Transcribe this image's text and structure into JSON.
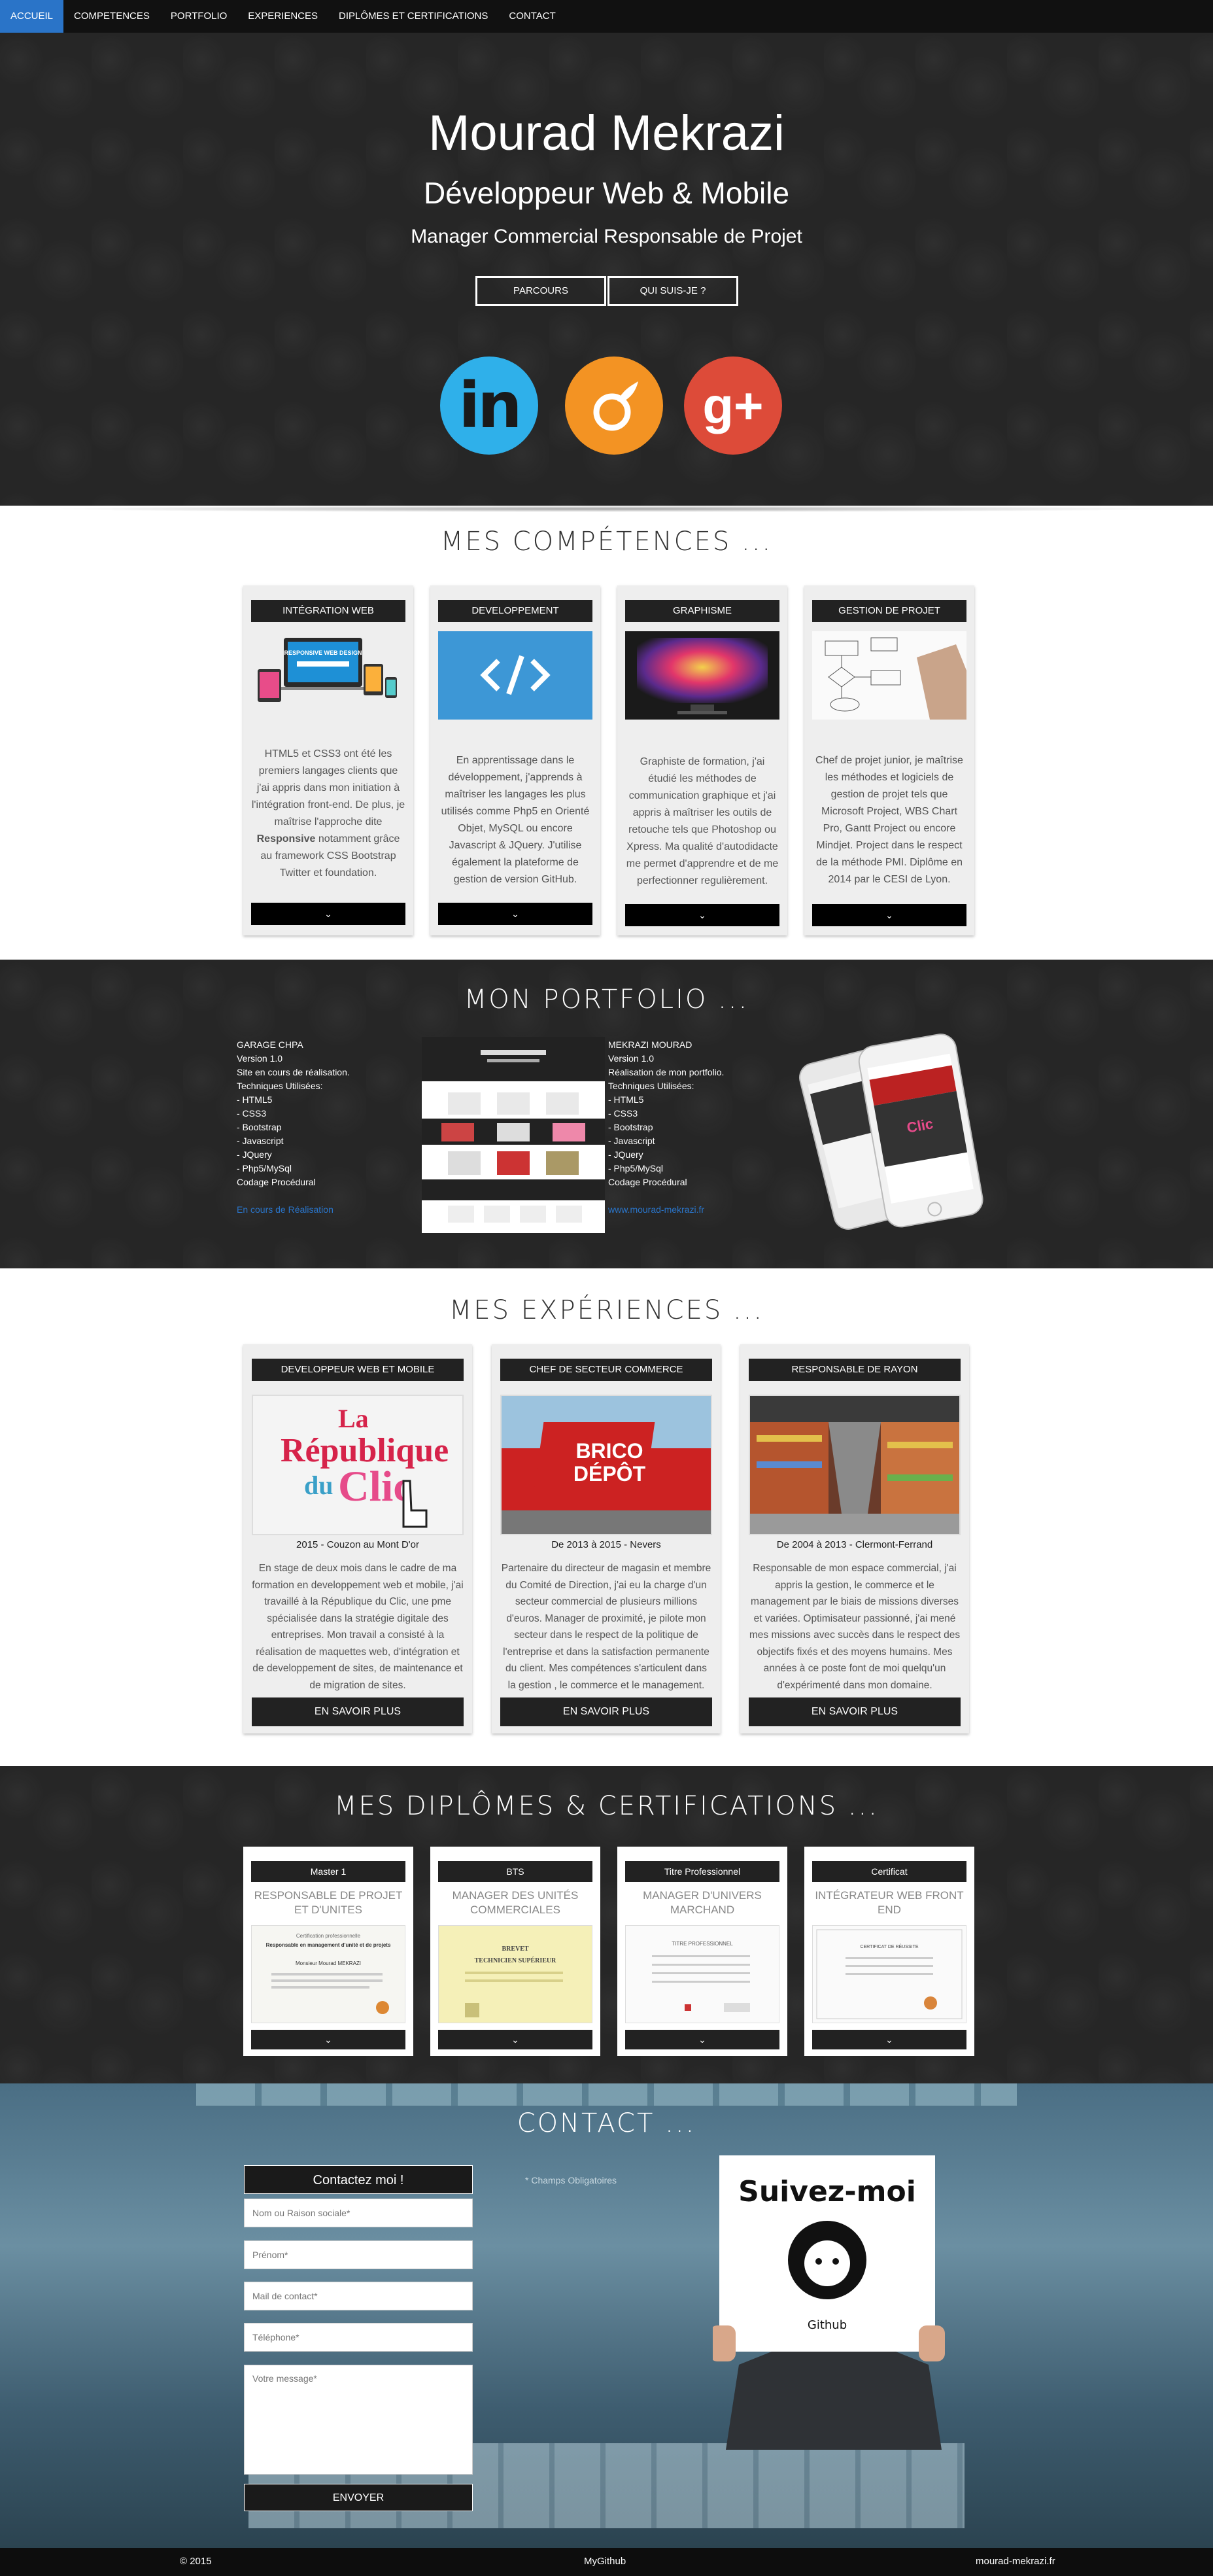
{
  "nav": {
    "items": [
      "ACCUEIL",
      "COMPETENCES",
      "PORTFOLIO",
      "EXPERIENCES",
      "DIPLÔMES ET CERTIFICATIONS",
      "CONTACT"
    ],
    "active_index": 0,
    "active_color": "#2a74c8"
  },
  "hero": {
    "name": "Mourad Mekrazi",
    "title1": "Développeur Web & Mobile",
    "title2": "Manager Commercial Responsable de Projet",
    "btn_parcours": "PARCOURS",
    "btn_qui": "QUI SUIS-JE ?",
    "social": {
      "linkedin_icon": "linkedin-icon",
      "linkedin_text": "in",
      "viadeo_icon": "viadeo-icon",
      "gplus_icon": "google-plus-icon",
      "gplus_text": "g+"
    }
  },
  "skills": {
    "title": "MES COMPÉTENCES ...",
    "cards": [
      {
        "tag": "INTÉGRATION WEB",
        "text_pre": "HTML5 et CSS3 ont été les premiers langages clients que j'ai appris dans mon initiation à l'intégration front-end. De plus, je maîtrise l'approche dite ",
        "text_bold": "Responsive",
        "text_post": " notamment grâce au framework CSS Bootstrap Twitter et foundation.",
        "more": "⌄"
      },
      {
        "tag": "DEVELOPPEMENT",
        "text": "En apprentissage dans le développement, j'apprends à maîtriser les langages les plus utilisés comme Php5 en Orienté Objet, MySQL ou encore Javascript & JQuery. J'utilise également la plateforme de gestion de version GitHub.",
        "more": "⌄"
      },
      {
        "tag": "GRAPHISME",
        "text": "Graphiste de formation, j'ai étudié les méthodes de communication graphique et j'ai appris à maîtriser les outils de retouche tels que Photoshop ou Xpress. Ma qualité d'autodidacte me permet d'apprendre et de me perfectionner regulièrement.",
        "more": "⌄"
      },
      {
        "tag": "GESTION DE PROJET",
        "text": "Chef de projet junior, je maîtrise les méthodes et logiciels de gestion de projet tels que Microsoft Project, WBS Chart Pro, Gantt Project ou encore Mindjet. Project dans le respect de la méthode PMI. Diplôme en 2014 par le CESI de Lyon.",
        "more": "⌄"
      }
    ],
    "responsive_design_img_label": "RESPONSIVE WEB DESIGN"
  },
  "portfolio": {
    "title": "MON PORTFOLIO ...",
    "project1": {
      "lines": [
        "GARAGE CHPA",
        "Version 1.0",
        "Site en cours de réalisation.",
        "Techniques Utilisées:",
        "- HTML5",
        "- CSS3",
        "- Bootstrap",
        "- Javascript",
        "- JQuery",
        "- Php5/MySql",
        "Codage Procédural"
      ],
      "link": "En cours de Réalisation"
    },
    "project2": {
      "lines": [
        "MEKRAZI MOURAD",
        "Version 1.0",
        "Réalisation de mon portfolio.",
        "Techniques Utilisées:",
        "- HTML5",
        "- CSS3",
        "- Bootstrap",
        "- Javascript",
        "- JQuery",
        "- Php5/MySql",
        "Codage Procédural"
      ],
      "link": "www.mourad-mekrazi.fr"
    }
  },
  "experiences": {
    "title": "MES EXPÉRIENCES ...",
    "cards": [
      {
        "tag": "DEVELOPPEUR WEB ET MOBILE",
        "logo_line1": "La",
        "logo_line2": "République",
        "logo_line3": "du",
        "logo_line4": "Clic",
        "date": "2015 - Couzon au Mont D'or",
        "text": "En stage de deux mois dans le cadre de ma formation en developpement web et mobile, j'ai travaillé à la République du Clic, une pme spécialisée dans la stratégie digitale des entreprises. Mon travail a consisté à la réalisation de maquettes web, d'intégration et de developpement de sites, de maintenance et de migration de sites.",
        "more": "EN SAVOIR PLUS"
      },
      {
        "tag": "CHEF DE SECTEUR COMMERCE",
        "store_sign_line1": "BRICO",
        "store_sign_line2": "DÉPÔT",
        "date": "De 2013 à 2015 - Nevers",
        "text": "Partenaire du directeur de magasin et membre du Comité de Direction, j'ai eu la charge d'un secteur commercial de plusieurs millions d'euros. Manager de proximité, je pilote mon secteur dans le respect de la politique de l'entreprise et dans la satisfaction permanente du client. Mes compétences s'articulent dans la gestion , le commerce et le management.",
        "more": "EN SAVOIR PLUS"
      },
      {
        "tag": "RESPONSABLE DE RAYON",
        "date": "De 2004 à 2013 - Clermont-Ferrand",
        "text": "Responsable de mon espace commercial, j'ai appris la gestion, le commerce et le management par le biais de missions diverses et variées. Optimisateur passionné, j'ai mené mes missions avec succès dans le respect des objectifs fixés et des moyens humains. Mes années à ce poste font de moi quelqu'un d'expérimenté dans mon domaine.",
        "more": "EN SAVOIR PLUS"
      }
    ]
  },
  "diplomas": {
    "title": "MES DIPLÔMES & CERTIFICATIONS ...",
    "cards": [
      {
        "tag": "Master 1",
        "name": "RESPONSABLE DE PROJET ET D'UNITES",
        "more": "⌄"
      },
      {
        "tag": "BTS",
        "name": "MANAGER DES UNITÉS COMMERCIALES",
        "more": "⌄"
      },
      {
        "tag": "Titre Professionnel",
        "name": "MANAGER D'UNIVERS MARCHAND",
        "more": "⌄"
      },
      {
        "tag": "Certificat",
        "name": "INTÉGRATEUR WEB FRONT END",
        "more": "⌄"
      }
    ],
    "cert1_line1": "Certification professionnelle",
    "cert1_line2": "Responsable en management d'unité et de projets",
    "cert1_name": "Monsieur Mourad MEKRAZI",
    "cert2_line1": "BREVET",
    "cert2_line2": "TECHNICIEN SUPÉRIEUR",
    "cert3_line1": "TITRE PROFESSIONNEL",
    "cert4_line1": "CERTIFICAT DE RÉUSSITE"
  },
  "contact": {
    "title": "CONTACT ...",
    "form_header": "Contactez moi !",
    "placeholders": {
      "company": "Nom ou Raison sociale*",
      "firstname": "Prénom*",
      "email": "Mail de contact*",
      "phone": "Téléphone*",
      "message": "Votre message*"
    },
    "required_note": "* Champs Obligatoires",
    "send": "ENVOYER",
    "follow_title": "Suivez-moi",
    "follow_sub": "Github"
  },
  "footer": {
    "copyright": "© 2015",
    "github": "MyGithub",
    "site": "mourad-mekrazi.fr"
  }
}
